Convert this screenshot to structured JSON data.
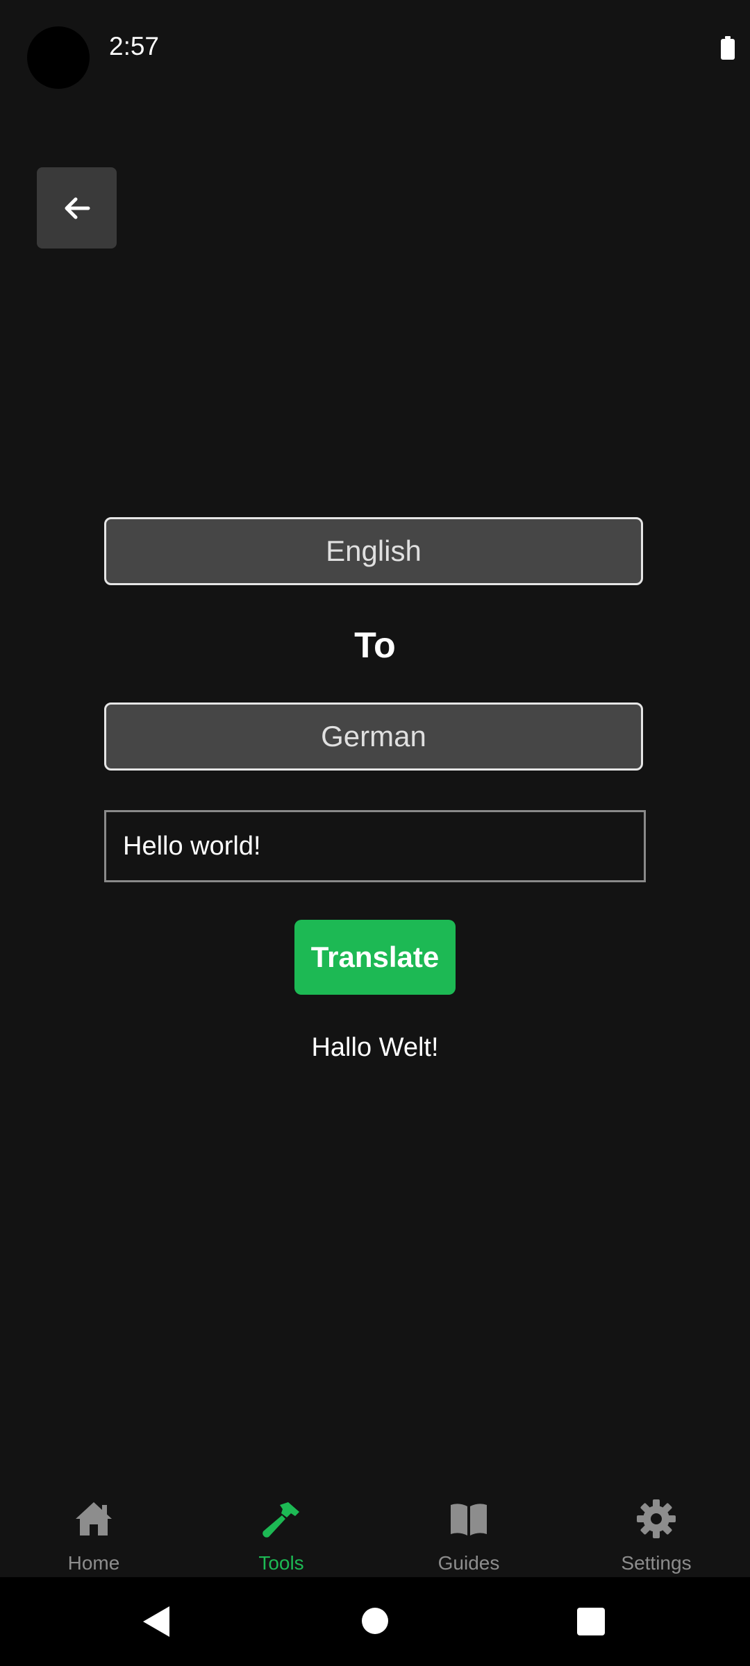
{
  "status_bar": {
    "time": "2:57"
  },
  "back_button": {
    "icon": "arrow-left-icon"
  },
  "translator": {
    "source_language": "English",
    "connector_label": "To",
    "target_language": "German",
    "input_value": "Hello world!",
    "translate_button_label": "Translate",
    "result": "Hallo Welt!"
  },
  "bottom_nav": {
    "items": [
      {
        "label": "Home",
        "icon": "home-icon",
        "active": false
      },
      {
        "label": "Tools",
        "icon": "hammer-icon",
        "active": true
      },
      {
        "label": "Guides",
        "icon": "book-icon",
        "active": false
      },
      {
        "label": "Settings",
        "icon": "gear-icon",
        "active": false
      }
    ]
  },
  "colors": {
    "background": "#131313",
    "accent": "#1db954",
    "inactive_nav": "#8d8d8d",
    "selector_fill": "#464646"
  }
}
